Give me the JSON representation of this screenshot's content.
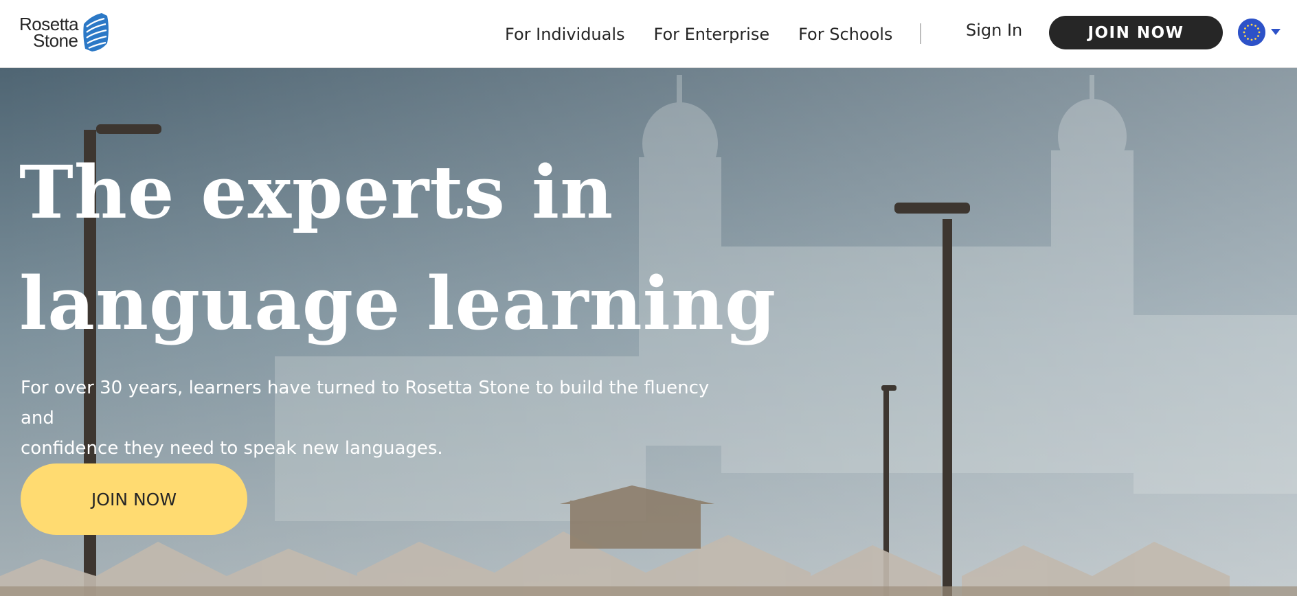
{
  "header": {
    "logo": {
      "line1": "Rosetta",
      "line2": "Stone"
    },
    "nav": [
      {
        "label": "For Individuals"
      },
      {
        "label": "For Enterprise"
      },
      {
        "label": "For Schools"
      }
    ],
    "sign_in": "Sign In",
    "join_now": "JOIN NOW",
    "locale_icon": "eu-flag-icon",
    "dropdown_icon": "chevron-down-icon"
  },
  "hero": {
    "title_line1": "The experts in",
    "title_line2": "language learning",
    "subtitle_line1": "For over 30 years, learners have turned to Rosetta Stone to build the fluency and",
    "subtitle_line2": "confidence they need to speak new languages.",
    "cta": "JOIN NOW"
  },
  "colors": {
    "header_bg": "#ffffff",
    "text_dark": "#262626",
    "cta_dark": "#262626",
    "cta_yellow": "#ffdb71",
    "flag_blue": "#2d52c8",
    "logo_blue": "#2b78c6"
  }
}
